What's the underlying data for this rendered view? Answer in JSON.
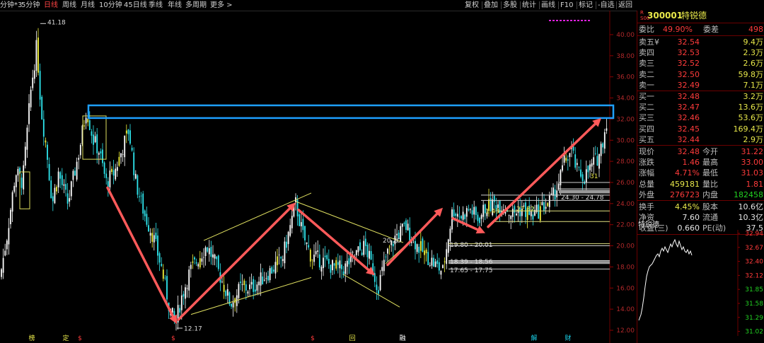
{
  "toolbar": {
    "left": [
      {
        "label": "分钟*3",
        "name": "period-3min"
      },
      {
        "label": "5分钟",
        "name": "period-5min"
      },
      {
        "label": "日线",
        "name": "period-day",
        "active": true
      },
      {
        "label": "周线",
        "name": "period-week"
      },
      {
        "label": "月线",
        "name": "period-month"
      },
      {
        "label": "10分钟",
        "name": "period-10min"
      },
      {
        "label": "45日线",
        "name": "period-45day"
      },
      {
        "label": "季线",
        "name": "period-quarter"
      },
      {
        "label": "年线",
        "name": "period-year"
      },
      {
        "label": "多周期",
        "name": "period-multi"
      },
      {
        "label": "更多 >",
        "name": "period-more"
      }
    ],
    "right": [
      {
        "label": "复权",
        "name": "btn-adjust"
      },
      {
        "label": "叠加",
        "name": "btn-overlay"
      },
      {
        "label": "多股",
        "name": "btn-multi-stock"
      },
      {
        "label": "统计",
        "name": "btn-stats"
      },
      {
        "label": "画线",
        "name": "btn-draw"
      },
      {
        "label": "F10",
        "name": "btn-f10"
      },
      {
        "label": "标记",
        "name": "btn-mark"
      },
      {
        "label": "-自选",
        "name": "btn-watchlist"
      },
      {
        "label": "返回",
        "name": "btn-back"
      }
    ]
  },
  "chart": {
    "price_ticks": [
      "40.00",
      "38.00",
      "36.00",
      "34.00",
      "32.00",
      "30.00",
      "28.00",
      "26.00",
      "24.00",
      "22.00",
      "20.00",
      "18.00",
      "16.00",
      "14.00",
      "12.00",
      "10.00"
    ],
    "annotations": {
      "high": "41.18",
      "low": "12.17",
      "zone1": "20.20",
      "zone2": "19.80 - 20.01",
      "zone3": "18.39 - 18.56",
      "zone4": "17.65 - 17.75",
      "zone5": "24.30 - 24.78",
      "mark1": "1.43",
      "mark2": "22.82",
      "mark3": "31"
    },
    "bottom_marks": [
      "榜",
      "定",
      "$",
      "$",
      "$",
      "回",
      "融",
      "解",
      "财"
    ],
    "colors": {
      "up": "#ffffff",
      "down": "#2ee6ee",
      "arrow": "#ff5a5a",
      "highlight_box": "#1e9fff",
      "channel": "#e0e060",
      "zone": "#cfcfcf"
    }
  },
  "quote": {
    "market_tag_top": "R",
    "market_tag_bottom": "S00",
    "code": "300001",
    "name": "特锐德",
    "weibi_label": "委比",
    "weibi": "49.90%",
    "weicha_label": "委差",
    "weicha": "498",
    "asks": [
      {
        "label": "卖五¥",
        "price": "32.54",
        "vol": "9.4万"
      },
      {
        "label": "卖四",
        "price": "32.53",
        "vol": "2.3万"
      },
      {
        "label": "卖三",
        "price": "32.52",
        "vol": "2.6万"
      },
      {
        "label": "卖二",
        "price": "32.50",
        "vol": "59.8万"
      },
      {
        "label": "卖一",
        "price": "32.49",
        "vol": "7.1万"
      }
    ],
    "bids": [
      {
        "label": "买一",
        "price": "32.48",
        "vol": "3.2万"
      },
      {
        "label": "买二",
        "price": "32.47",
        "vol": "13.6万"
      },
      {
        "label": "买三",
        "price": "32.46",
        "vol": "53.6万"
      },
      {
        "label": "买四",
        "price": "32.45",
        "vol": "169.4万"
      },
      {
        "label": "买五",
        "price": "32.44",
        "vol": "2.9万"
      }
    ],
    "stats": [
      {
        "l1": "现价",
        "v1": "32.48",
        "c1": "red",
        "l2": "今开",
        "v2": "31.22",
        "c2": "red"
      },
      {
        "l1": "涨跌",
        "v1": "1.46",
        "c1": "red",
        "l2": "最高",
        "v2": "33.00",
        "c2": "red"
      },
      {
        "l1": "涨幅",
        "v1": "4.71%",
        "c1": "red",
        "l2": "最低",
        "v2": "31.03",
        "c2": "red"
      },
      {
        "l1": "总量",
        "v1": "459181",
        "c1": "yellow",
        "l2": "量比",
        "v2": "1.81",
        "c2": "red"
      },
      {
        "l1": "外盘",
        "v1": "276723",
        "c1": "red",
        "l2": "内盘",
        "v2": "182458",
        "c2": "green"
      }
    ],
    "stats2": [
      {
        "l1": "换手",
        "v1": "4.45%",
        "c1": "yellow",
        "l2": "股本",
        "v2": "10.6亿",
        "c2": "white"
      },
      {
        "l1": "净资",
        "v1": "7.60",
        "c1": "white",
        "l2": "流通",
        "v2": "10.3亿",
        "c2": "white"
      },
      {
        "l1": "收益(三)",
        "v1": "0.660",
        "c1": "white",
        "l2": "PE(动)",
        "v2": "37.5",
        "c2": "white"
      }
    ],
    "mini_title": "特锐德",
    "mini_ticks": [
      "32.94",
      "32.67",
      "32.40",
      "32.12",
      "31.85",
      "31.58",
      "31.29",
      "31.02"
    ]
  }
}
